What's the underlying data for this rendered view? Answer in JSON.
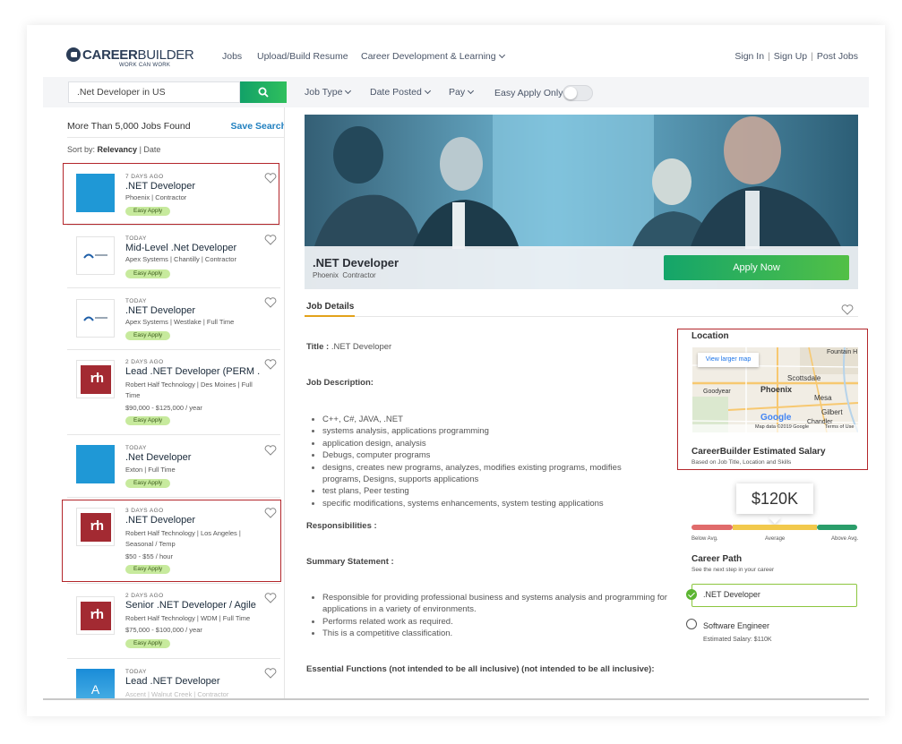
{
  "header": {
    "logo_text_bold": "CAREER",
    "logo_text_light": "BUILDER",
    "logo_tagline": "WORK CAN WORK",
    "nav": [
      "Jobs",
      "Upload/Build Resume",
      "Career Development & Learning"
    ],
    "right_links": [
      "Sign In",
      "Sign Up",
      "Post Jobs"
    ]
  },
  "search": {
    "value": ".Net Developer in US",
    "filters": [
      "Job Type",
      "Date Posted",
      "Pay"
    ],
    "easy_apply_label": "Easy Apply Only",
    "easy_apply_on": false
  },
  "results": {
    "count": "More Than 5,000 Jobs Found",
    "save_search": "Save Search",
    "sort_label": "Sort by:",
    "sort_active": "Relevancy",
    "sort_other": "Date",
    "easy_apply_badge": "Easy Apply",
    "cards": [
      {
        "ago": "7 DAYS AGO",
        "title": ".NET Developer",
        "meta": "Phoenix | Contractor",
        "salary": "",
        "logo": "blue"
      },
      {
        "ago": "TODAY",
        "title": "Mid-Level .Net Developer",
        "meta": "Apex Systems | Chantilly | Contractor",
        "salary": "",
        "logo": "apex"
      },
      {
        "ago": "TODAY",
        "title": ".NET Developer",
        "meta": "Apex Systems | Westlake | Full Time",
        "salary": "",
        "logo": "apex"
      },
      {
        "ago": "2 DAYS AGO",
        "title": "Lead .NET Developer (PERM ...",
        "meta": "Robert Half Technology | Des Moines | Full Time",
        "salary": "$90,000 - $125,000 / year",
        "logo": "rh"
      },
      {
        "ago": "TODAY",
        "title": ".Net Developer",
        "meta": "Exton | Full Time",
        "salary": "",
        "logo": "blue"
      },
      {
        "ago": "3 DAYS AGO",
        "title": ".NET Developer",
        "meta": "Robert Half Technology | Los Angeles | Seasonal / Temp",
        "salary": "$50 - $55 / hour",
        "logo": "rh"
      },
      {
        "ago": "2 DAYS AGO",
        "title": "Senior .NET Developer / Agile ...",
        "meta": "Robert Half Technology | WDM | Full Time",
        "salary": "$75,000 - $100,000 / year",
        "logo": "rh"
      },
      {
        "ago": "TODAY",
        "title": "Lead .NET Developer",
        "meta": "Ascent | Walnut Creek | Contractor",
        "salary": "",
        "logo": "a"
      }
    ]
  },
  "detail": {
    "title": ".NET Developer",
    "location": "Phoenix",
    "type": "Contractor",
    "apply_label": "Apply Now",
    "tab": "Job Details",
    "title_label": "Title :",
    "title_value": ".NET Developer",
    "job_description_label": "Job Description:",
    "description_items": [
      "C++, C#, JAVA, .NET",
      "systems analysis, applications programming",
      "application design, analysis",
      "Debugs, computer programs",
      "designs, creates new programs, analyzes, modifies existing programs, modifies programs, Designs, supports applications",
      "test plans, Peer testing",
      "specific modifications, systems enhancements, system testing applications"
    ],
    "responsibilities_label": "Responsibilities :",
    "summary_label": "Summary Statement :",
    "summary_items": [
      "Responsible for providing professional business and systems analysis and programming for applications in a variety of environments.",
      "Performs related work as required.",
      "This is a competitive classification."
    ],
    "essential_label": "Essential Functions (not intended to be all inclusive) (not intended to be all inclusive):"
  },
  "sidebar": {
    "location_label": "Location",
    "map_button": "View larger map",
    "map_places": [
      "Fountain H",
      "Scottsdale",
      "Phoenix",
      "Goodyear",
      "Mesa",
      "Gilbert",
      "Chandler"
    ],
    "map_brand": "Google",
    "map_credit": "Map data ©2019 Google",
    "map_terms": "Terms of Use",
    "salary_label": "CareerBuilder Estimated Salary",
    "salary_sub": "Based on Job Title, Location and Skills",
    "salary_value": "$120K",
    "bar_labels": [
      "Below Avg.",
      "Average",
      "Above Avg."
    ],
    "career_path_label": "Career Path",
    "career_path_sub": "See the next step in your career",
    "path_current": ".NET Developer",
    "path_next": "Software Engineer",
    "path_next_salary": "Estimated Salary: $110K"
  },
  "colors": {
    "accent_green": "#2fbf5d",
    "link_blue": "#1f7fbf",
    "highlight_red": "#b3262b",
    "tab_underline": "#e3a21a",
    "bar_below": "#e06b6b",
    "bar_average": "#f2c94c",
    "bar_above": "#2a9d6a"
  }
}
